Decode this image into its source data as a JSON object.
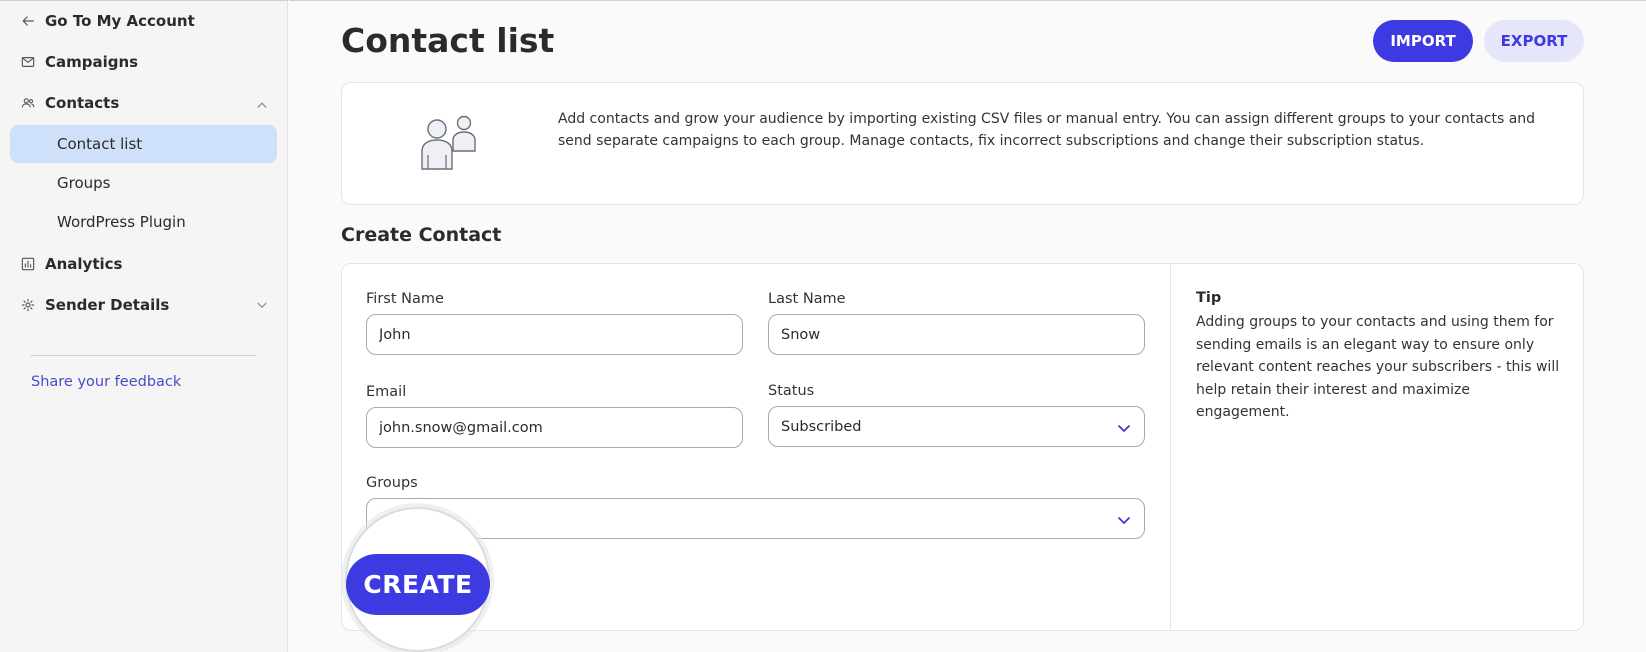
{
  "sidebar": {
    "back_label": "Go To My Account",
    "campaigns_label": "Campaigns",
    "contacts_label": "Contacts",
    "contacts_sub": [
      "Contact list",
      "Groups",
      "WordPress Plugin"
    ],
    "analytics_label": "Analytics",
    "sender_details_label": "Sender Details",
    "feedback_label": "Share your feedback"
  },
  "header": {
    "title": "Contact list",
    "import_label": "IMPORT",
    "export_label": "EXPORT"
  },
  "info": {
    "text": "Add contacts and grow your audience by importing existing CSV files or manual entry. You can assign different groups to your contacts and send separate campaigns to each group. Manage contacts, fix incorrect subscriptions and change their subscription status."
  },
  "form": {
    "section_title": "Create Contact",
    "first_name_label": "First Name",
    "first_name_value": "John",
    "last_name_label": "Last Name",
    "last_name_value": "Snow",
    "email_label": "Email",
    "email_value": "john.snow@gmail.com",
    "status_label": "Status",
    "status_value": "Subscribed",
    "groups_label": "Groups",
    "groups_placeholder": "…ps",
    "create_label": "CREATE"
  },
  "tip": {
    "title": "Tip",
    "text": "Adding groups to your contacts and using them for sending emails is an elegant way to ensure only relevant content reaches your subscribers - this will help retain their interest and maximize engagement."
  },
  "colors": {
    "primary": "#3c3ae0",
    "active_nav_bg": "#cfe0fb",
    "link": "#4a49c9"
  }
}
